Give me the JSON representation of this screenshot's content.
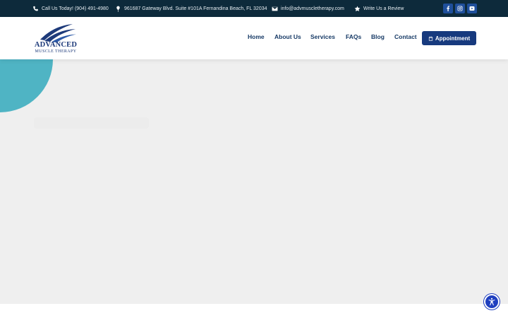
{
  "topbar": {
    "phone": {
      "text": "Call Us Today! (904) 491-4980",
      "icon": "phone-icon"
    },
    "address": {
      "text": "961687 Gateway Blvd. Suite #101A Fernandina Beach, FL 32034",
      "icon": "map-pin-icon"
    },
    "email": {
      "text": "info@advmuscletherapy.com",
      "icon": "envelope-icon"
    },
    "review": {
      "text": "Write Us a Review",
      "icon": "star-icon"
    },
    "social": [
      "facebook-icon",
      "instagram-icon",
      "youtube-icon"
    ]
  },
  "header": {
    "logo": {
      "line1": "ADVANCED",
      "line2": "MUSCLE THERAPY"
    },
    "nav": {
      "home": "Home",
      "about": "About Us",
      "services": "Services",
      "faqs": "FAQs",
      "blog": "Blog",
      "contact": "Contact"
    },
    "appointment_label": "Appointment"
  },
  "colors": {
    "topbar_bg": "#0d2a3b",
    "brand_blue": "#173a7e",
    "accent_teal": "#4fb4c4",
    "hero_bg": "#efefef",
    "a11y_blue": "#1f3fbf"
  }
}
